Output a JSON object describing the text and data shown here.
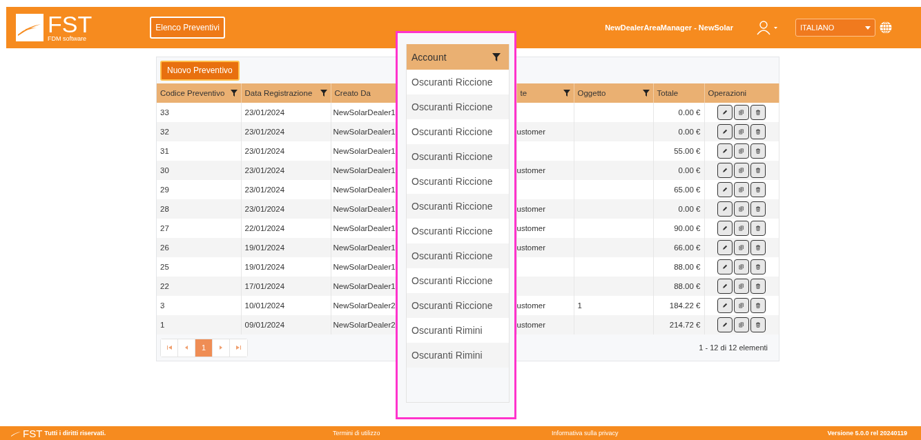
{
  "header": {
    "logo": {
      "name": "FST",
      "tagline": "FDM software"
    },
    "nav_button": "Elenco Preventivi",
    "user": "NewDealerAreaManager - NewSolar",
    "language": "ITALIANO"
  },
  "toolbar": {
    "new_button": "Nuovo Preventivo"
  },
  "table": {
    "columns": [
      {
        "label": "Codice Preventivo",
        "filter": true
      },
      {
        "label": "Data Registrazione",
        "filter": true
      },
      {
        "label": "Creato Da",
        "filter": false
      },
      {
        "label": "te",
        "filter": true
      },
      {
        "label": "Oggetto",
        "filter": true
      },
      {
        "label": "Totale",
        "filter": false
      },
      {
        "label": "Operazioni",
        "filter": false
      }
    ],
    "rows": [
      {
        "cells": [
          "33",
          "23/01/2024",
          "NewSolarDealer1",
          "",
          "",
          "0.00 €"
        ]
      },
      {
        "cells": [
          "32",
          "23/01/2024",
          "NewSolarDealer1",
          "ustomer",
          "",
          "0.00 €"
        ]
      },
      {
        "cells": [
          "31",
          "23/01/2024",
          "NewSolarDealer1",
          "",
          "",
          "55.00 €"
        ]
      },
      {
        "cells": [
          "30",
          "23/01/2024",
          "NewSolarDealer1",
          "ustomer",
          "",
          "0.00 €"
        ]
      },
      {
        "cells": [
          "29",
          "23/01/2024",
          "NewSolarDealer1",
          "",
          "",
          "65.00 €"
        ]
      },
      {
        "cells": [
          "28",
          "23/01/2024",
          "NewSolarDealer1",
          "ustomer",
          "",
          "0.00 €"
        ]
      },
      {
        "cells": [
          "27",
          "22/01/2024",
          "NewSolarDealer1",
          "ustomer",
          "",
          "90.00 €"
        ]
      },
      {
        "cells": [
          "26",
          "19/01/2024",
          "NewSolarDealer1",
          "ustomer",
          "",
          "66.00 €"
        ]
      },
      {
        "cells": [
          "25",
          "19/01/2024",
          "NewSolarDealer1",
          "",
          "",
          "88.00 €"
        ]
      },
      {
        "cells": [
          "22",
          "17/01/2024",
          "NewSolarDealer1",
          "",
          "",
          "88.00 €"
        ]
      },
      {
        "cells": [
          "3",
          "10/01/2024",
          "NewSolarDealer2",
          "ustomer",
          "1",
          "184.22 €"
        ]
      },
      {
        "cells": [
          "1",
          "09/01/2024",
          "NewSolarDealer2",
          "ustomer",
          "",
          "214.72 €"
        ]
      }
    ]
  },
  "pagination": {
    "pages": [
      {
        "label": "1",
        "selected": true
      }
    ],
    "summary": "1 - 12 di 12 elementi"
  },
  "account_popup": {
    "header": "Account",
    "filter": true,
    "items": [
      "Oscuranti Riccione",
      "Oscuranti Riccione",
      "Oscuranti Riccione",
      "Oscuranti Riccione",
      "Oscuranti Riccione",
      "Oscuranti Riccione",
      "Oscuranti Riccione",
      "Oscuranti Riccione",
      "Oscuranti Riccione",
      "Oscuranti Riccione",
      "Oscuranti Rimini",
      "Oscuranti Rimini"
    ]
  },
  "footer": {
    "logo": "FST",
    "copyright": "Tutti i diritti riservati.",
    "links": [
      "Termini di utilizzo",
      "Informativa sulla privacy"
    ],
    "version": "Versione 5.0.0 rel 20240119"
  }
}
